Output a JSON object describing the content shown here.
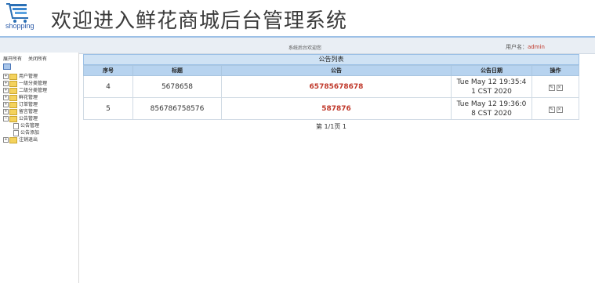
{
  "header": {
    "logo_text": "shopping",
    "title": "欢迎进入鲜花商城后台管理系统"
  },
  "topbar": {
    "welcome": "系统后台欢迎您",
    "user_label": "用户名：",
    "user_name": "admin"
  },
  "sidebar": {
    "expand_all": "展开所有",
    "collapse_all": "关闭所有",
    "items": [
      {
        "label": "用户管理"
      },
      {
        "label": "一级分类管理"
      },
      {
        "label": "二级分类管理"
      },
      {
        "label": "鲜花管理"
      },
      {
        "label": "订单管理"
      },
      {
        "label": "留言管理"
      },
      {
        "label": "公告管理"
      },
      {
        "label": "公告管理"
      },
      {
        "label": "公告添加"
      },
      {
        "label": "注销退出"
      }
    ]
  },
  "panel": {
    "title": "公告列表",
    "columns": [
      "序号",
      "标题",
      "公告",
      "公告日期",
      "操作"
    ],
    "rows": [
      {
        "id": "4",
        "title": "5678658",
        "content": "65785678678",
        "date1": "Tue May 12 19:35:4",
        "date2": "1 CST 2020"
      },
      {
        "id": "5",
        "title": "856786758576",
        "content": "587876",
        "date1": "Tue May 12 19:36:0",
        "date2": "8 CST 2020"
      }
    ],
    "pager": "第 1/1页 1"
  },
  "colors": {
    "accent": "#9cc0e6",
    "header_bg": "#b7d3ef",
    "highlight": "#c0392b"
  }
}
